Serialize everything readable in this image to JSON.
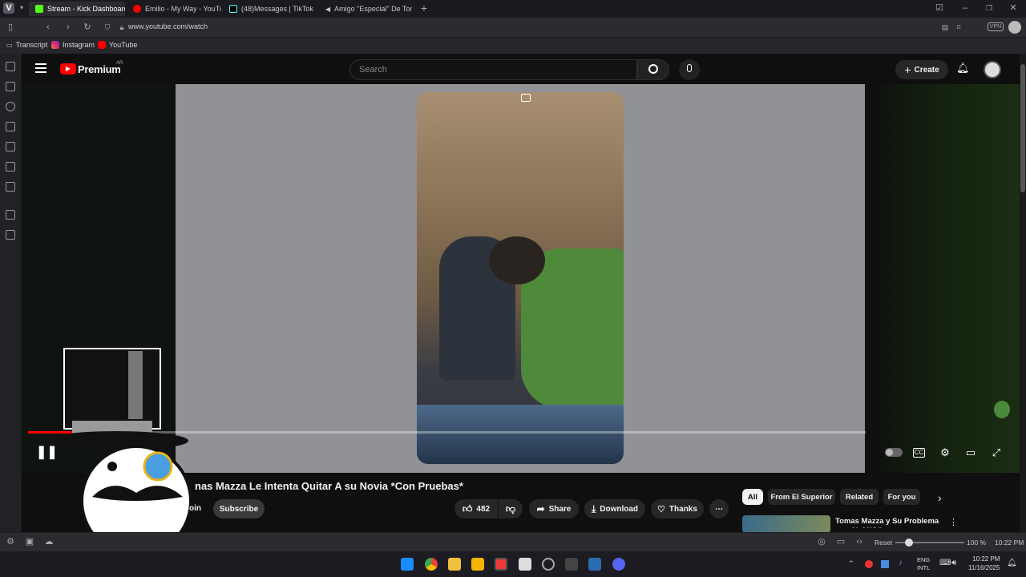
{
  "browser": {
    "tabs": [
      {
        "label": "Stream - Kick Dashboard",
        "color": "#53fc18"
      },
      {
        "label": "Emilio - My Way - YouTube",
        "color": "#ff0000"
      },
      {
        "label": "(48)Messages | TikTok",
        "color": "#000000"
      },
      {
        "label": "Amigo \"Especial\" De Tomas",
        "color": "#888888"
      }
    ],
    "url": "www.youtube.com/watch",
    "bookmarks": [
      "Transcript",
      "Instagram",
      "YouTube"
    ],
    "zoom_reset": "Reset",
    "zoom_level": "100 %",
    "status_time": "10:22 PM"
  },
  "youtube": {
    "logo_text": "Premium",
    "region": "AR",
    "search_placeholder": "Search",
    "create_label": "Create",
    "video_title": "nas Mazza Le Intenta Quitar A su Novia *Con Pruebas*",
    "join_label": "oin",
    "subscribe_label": "Subscribe",
    "like_count": "482",
    "share_label": "Share",
    "download_label": "Download",
    "thanks_label": "Thanks",
    "chips": [
      "All",
      "From El Superior",
      "Related",
      "For you"
    ],
    "recommendation_title": "Tomas Mazza y Su Problema con ALONSO",
    "progress_fraction": 0.06
  },
  "taskbar": {
    "lang": "ENG",
    "layout": "INTL",
    "time": "10:22 PM",
    "date": "11/16/2025"
  },
  "colors": {
    "yt_red": "#ff0000",
    "accent": "#f1f1f1"
  }
}
